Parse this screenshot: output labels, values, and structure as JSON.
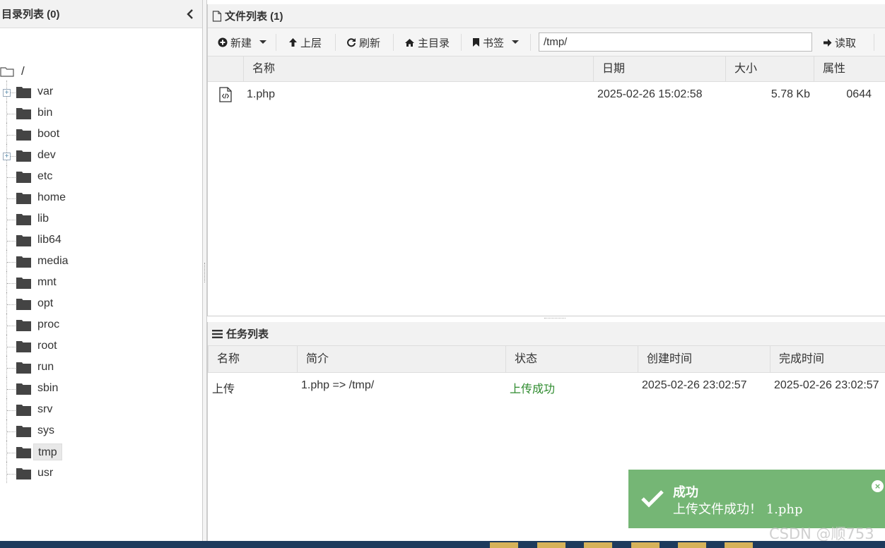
{
  "left_panel": {
    "title": "目录列表 (0)",
    "root_label": "/",
    "dirs": [
      {
        "name": "var",
        "expandable": true
      },
      {
        "name": "bin",
        "expandable": false
      },
      {
        "name": "boot",
        "expandable": false
      },
      {
        "name": "dev",
        "expandable": true
      },
      {
        "name": "etc",
        "expandable": false
      },
      {
        "name": "home",
        "expandable": false
      },
      {
        "name": "lib",
        "expandable": false
      },
      {
        "name": "lib64",
        "expandable": false
      },
      {
        "name": "media",
        "expandable": false
      },
      {
        "name": "mnt",
        "expandable": false
      },
      {
        "name": "opt",
        "expandable": false
      },
      {
        "name": "proc",
        "expandable": false
      },
      {
        "name": "root",
        "expandable": false
      },
      {
        "name": "run",
        "expandable": false
      },
      {
        "name": "sbin",
        "expandable": false
      },
      {
        "name": "srv",
        "expandable": false
      },
      {
        "name": "sys",
        "expandable": false
      },
      {
        "name": "tmp",
        "expandable": false,
        "selected": true
      },
      {
        "name": "usr",
        "expandable": false
      }
    ]
  },
  "file_panel": {
    "title": "文件列表 (1)",
    "toolbar": {
      "new_label": "新建",
      "up_label": "上层",
      "refresh_label": "刷新",
      "home_label": "主目录",
      "bookmark_label": "书签",
      "path_value": "/tmp/",
      "read_label": "读取"
    },
    "columns": {
      "name": "名称",
      "date": "日期",
      "size": "大小",
      "perm": "属性"
    },
    "files": [
      {
        "name": "1.php",
        "date": "2025-02-26 15:02:58",
        "size": "5.78 Kb",
        "perm": "0644"
      }
    ]
  },
  "task_panel": {
    "title": "任务列表",
    "columns": {
      "name": "名称",
      "desc": "简介",
      "status": "状态",
      "created": "创建时间",
      "finished": "完成时间"
    },
    "tasks": [
      {
        "name": "上传",
        "desc": "1.php => /tmp/",
        "status": "上传成功",
        "created": "2025-02-26 23:02:57",
        "finished": "2025-02-26 23:02:57"
      }
    ]
  },
  "toast": {
    "title": "成功",
    "message": "上传文件成功！ 1.php",
    "color": "#75b675"
  },
  "watermark": "CSDN @顺753"
}
